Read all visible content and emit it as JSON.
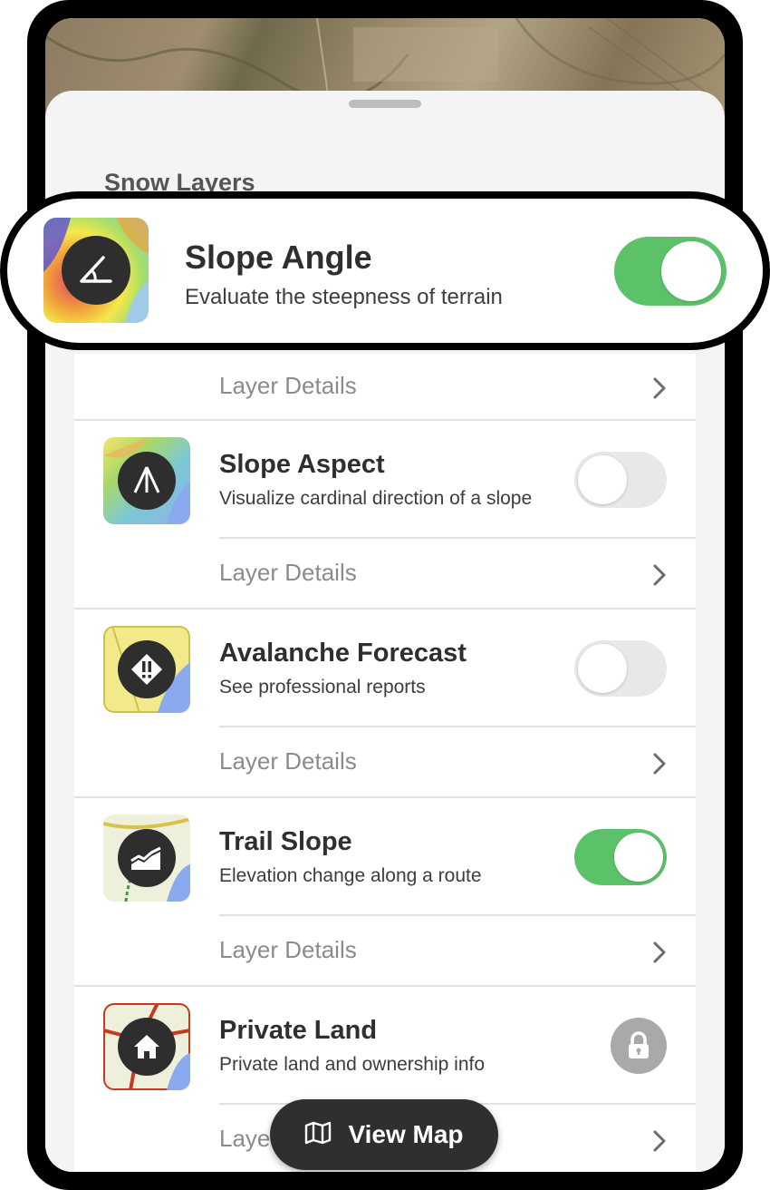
{
  "section_title": "Snow Layers",
  "highlighted_layer": {
    "title": "Slope Angle",
    "subtitle": "Evaluate the steepness of terrain",
    "enabled": true,
    "icon": "slope-angle-icon"
  },
  "layers": [
    {
      "title": "Slope Angle",
      "details_label": "Layer Details"
    },
    {
      "title": "Slope Aspect",
      "subtitle": "Visualize cardinal direction of a slope",
      "enabled": false,
      "icon": "north-arrow-icon",
      "details_label": "Layer Details"
    },
    {
      "title": "Avalanche Forecast",
      "subtitle": "See professional reports",
      "enabled": false,
      "icon": "warning-diamond-icon",
      "details_label": "Layer Details"
    },
    {
      "title": "Trail Slope",
      "subtitle": "Elevation change along a route",
      "enabled": true,
      "icon": "elevation-chart-icon",
      "details_label": "Layer Details"
    },
    {
      "title": "Private Land",
      "subtitle": "Private land and ownership info",
      "locked": true,
      "icon": "house-icon",
      "details_label": "Layer Details"
    }
  ],
  "view_map": {
    "label": "View Map",
    "icon": "map-icon"
  },
  "colors": {
    "toggle_on": "#5cc26a",
    "toggle_off": "#e8e8e8",
    "button_dark": "#2f2f2f"
  }
}
